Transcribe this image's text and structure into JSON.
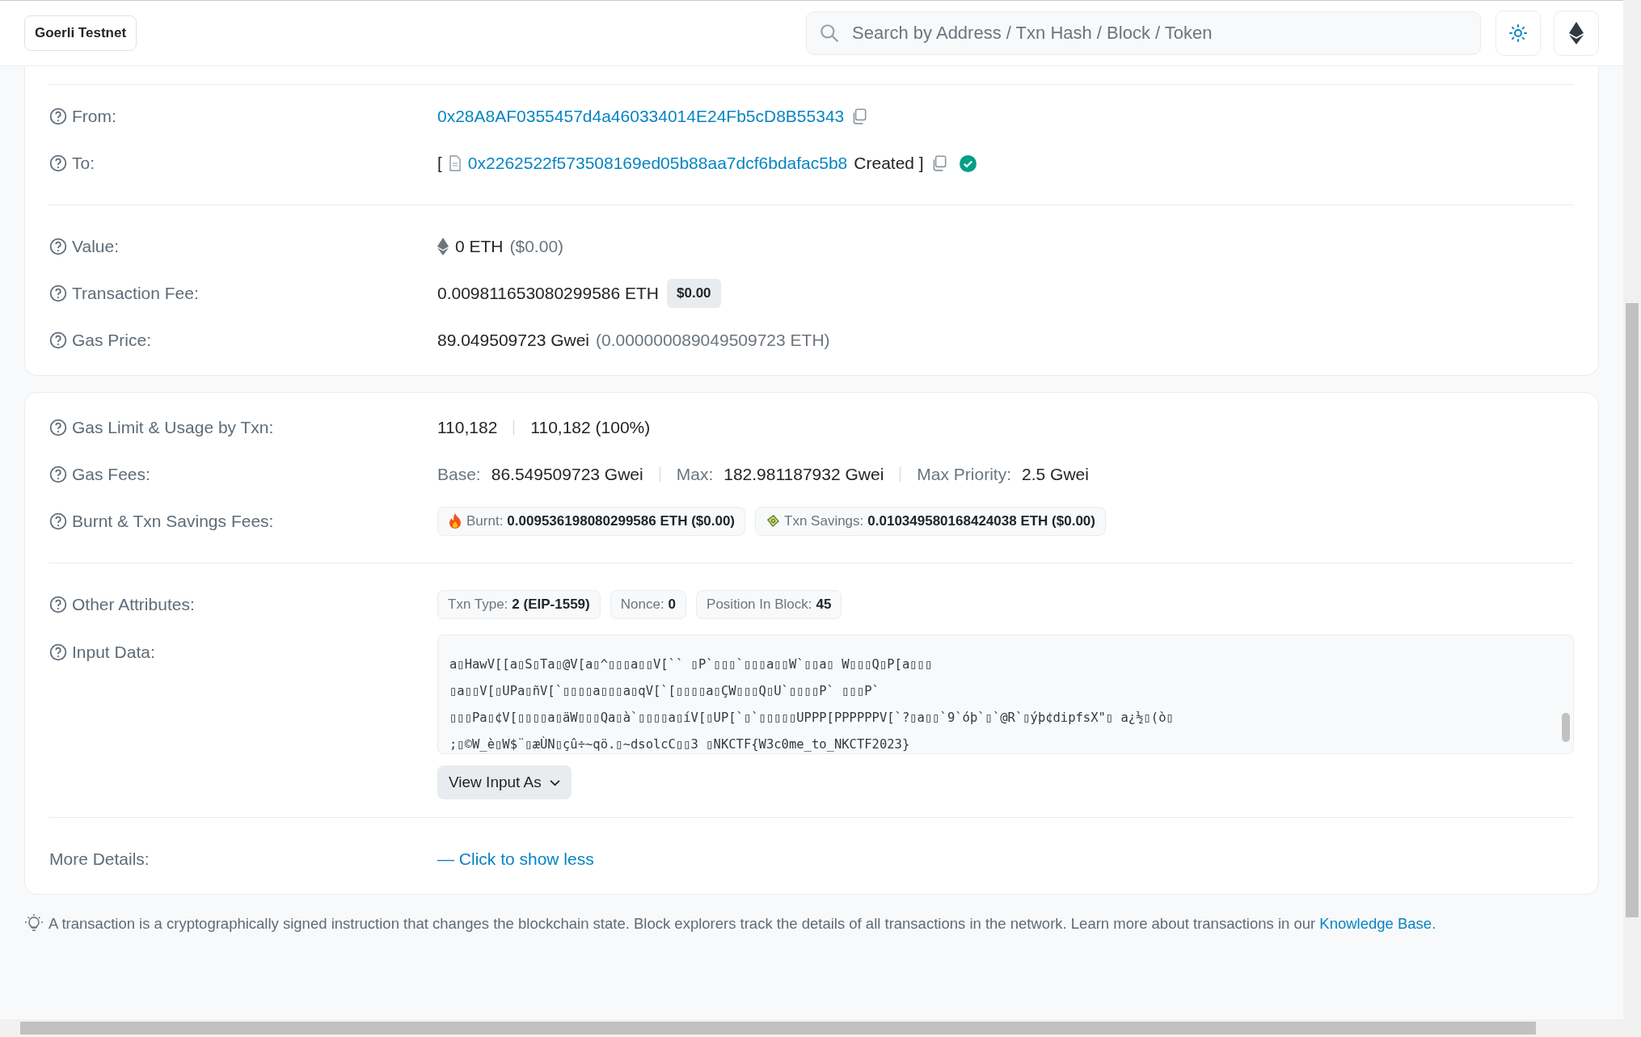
{
  "header": {
    "network_badge": "Goerli Testnet",
    "search": {
      "placeholder": "Search by Address / Txn Hash / Block / Token"
    }
  },
  "overview": {
    "from": {
      "label": "From:",
      "address": "0x28A8AF0355457d4a460334014E24Fb5cD8B55343"
    },
    "to": {
      "label": "To:",
      "open": "[",
      "address": "0x2262522f573508169ed05b88aa7dcf6bdafac5b8",
      "suffix": "Created ]",
      "verified": true
    },
    "value": {
      "label": "Value:",
      "amount": "0 ETH",
      "usd": "($0.00)"
    },
    "fee": {
      "label": "Transaction Fee:",
      "amount": "0.009811653080299586 ETH",
      "usd_badge": "$0.00"
    },
    "gas_price": {
      "label": "Gas Price:",
      "gwei": "89.049509723 Gwei",
      "eth": "(0.000000089049509723 ETH)"
    }
  },
  "gas": {
    "limit": {
      "label": "Gas Limit & Usage by Txn:",
      "limit": "110,182",
      "usage": "110,182 (100%)"
    },
    "fees": {
      "label": "Gas Fees:",
      "items": [
        {
          "name": "Base:",
          "value": "86.549509723 Gwei"
        },
        {
          "name": "Max:",
          "value": "182.981187932 Gwei"
        },
        {
          "name": "Max Priority:",
          "value": "2.5 Gwei"
        }
      ]
    },
    "burnt": {
      "label": "Burnt & Txn Savings Fees:",
      "chips": [
        {
          "kind": "burnt",
          "name": "Burnt:",
          "value": "0.009536198080299586 ETH ($0.00)"
        },
        {
          "kind": "savings",
          "name": "Txn Savings:",
          "value": "0.010349580168424038 ETH ($0.00)"
        }
      ]
    },
    "other": {
      "label": "Other Attributes:",
      "chips": [
        {
          "name": "Txn Type:",
          "value": "2 (EIP-1559)"
        },
        {
          "name": "Nonce:",
          "value": "0"
        },
        {
          "name": "Position In Block:",
          "value": "45"
        }
      ]
    },
    "input": {
      "label": "Input Data:",
      "lines": [
        "a▯HawV[[a▯S▯Ta▯@V[a▯^▯▯▯a▯▯V[`` ▯P`▯▯▯`▯▯▯a▯▯W`▯▯a▯ W▯▯▯Q▯P[a▯▯▯",
        "▯a▯▯V[▯UPa▯ñV[`▯▯▯▯a▯▯▯a▯qV[`[▯▯▯▯a▯ÇW▯▯▯Q▯U`▯▯▯▯P` ▯▯▯P`",
        "▯▯▯Pa▯¢V[▯▯▯▯a▯äW▯▯▯Qa▯à`▯▯▯▯a▯íV[▯UP[`▯`▯▯▯▯▯UPPP[PPPPPPV[`?▯a▯▯`9`óþ`▯`@R`▯ýþ¢dipfsX\"▯ a¿½▯(ò▯",
        ";▯©W_è▯W$¨▯æÙN▯çû÷~qö.▯~dsolcC▯▯3 ▯NKCTF{W3c0me_to_NKCTF2023}"
      ],
      "button": "View Input As"
    },
    "more": {
      "label": "More Details:",
      "link": "— Click to show less"
    }
  },
  "footer": {
    "text": "A transaction is a cryptographically signed instruction that changes the blockchain state. Block explorers track the details of all transactions in the network. Learn more about transactions in our",
    "link": "Knowledge Base",
    "end": "."
  }
}
